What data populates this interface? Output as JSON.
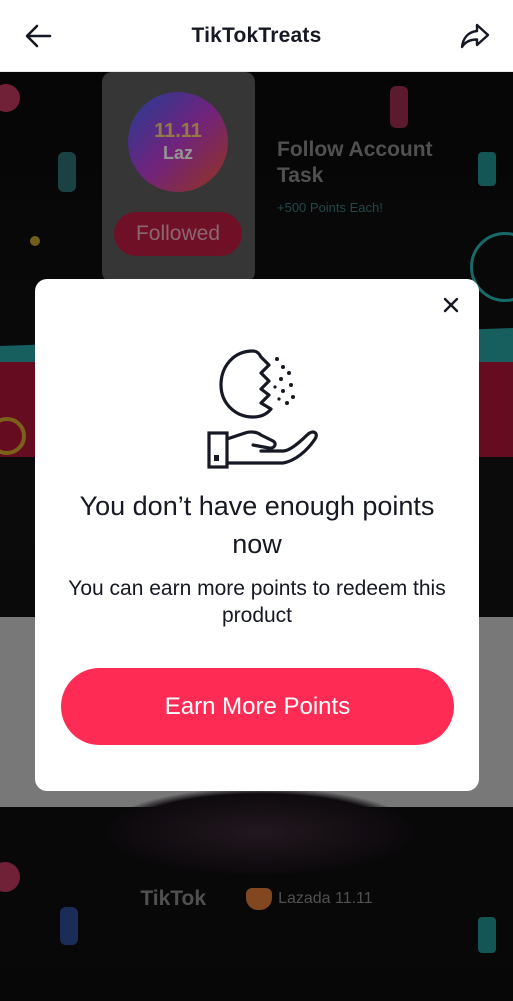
{
  "header": {
    "title": "TikTokTreats",
    "back_icon": "arrow-left-icon",
    "share_icon": "share-arrow-icon"
  },
  "background": {
    "logo_top": "11.11",
    "logo_bottom": "Laz",
    "followed_label": "Followed",
    "task_title": "Follow Account Task",
    "task_subtitle": "+500 Points Each!",
    "footer_tiktok": "TikTok",
    "footer_lazada": "Lazada 11.11"
  },
  "modal": {
    "heading": "You don’t have enough points now",
    "description": "You can earn more points to redeem this product",
    "cta_label": "Earn More Points",
    "close_icon": "close-icon",
    "illustration_icon": "coin-in-hand-icon"
  },
  "colors": {
    "accent": "#fe2c55",
    "header_bg": "#ffffff",
    "modal_bg": "#ffffff",
    "text": "#161823"
  }
}
